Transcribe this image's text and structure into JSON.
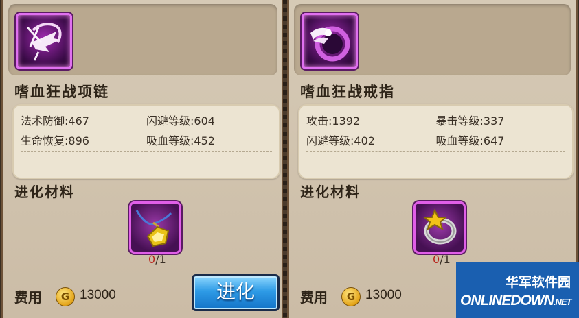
{
  "left": {
    "item_name": "嗜血狂战项链",
    "stats": [
      {
        "label": "法术防御:467"
      },
      {
        "label": "闪避等级:604"
      },
      {
        "label": "生命恢复:896"
      },
      {
        "label": "吸血等级:452"
      }
    ],
    "evolution_title": "进化材料",
    "material_count_current": "0",
    "material_count_total": "/1",
    "cost_label": "费用",
    "coin_symbol": "G",
    "cost_value": "13000",
    "evolve_button_label": "进化"
  },
  "right": {
    "item_name": "嗜血狂战戒指",
    "stats": [
      {
        "label": "攻击:1392"
      },
      {
        "label": "暴击等级:337"
      },
      {
        "label": "闪避等级:402"
      },
      {
        "label": "吸血等级:647"
      }
    ],
    "evolution_title": "进化材料",
    "material_count_current": "0",
    "material_count_total": "/1",
    "cost_label": "费用",
    "coin_symbol": "G",
    "cost_value": "13000"
  },
  "watermark": {
    "cn": "华军软件园",
    "en": "ONLINEDOWN",
    "en_suffix": ".NET"
  },
  "colors": {
    "panel_bg": "#d6cab6",
    "stats_bg": "#ece4d2",
    "item_frame": "#e070f0",
    "button_blue": "#2e9be6",
    "count_red": "#b8231b",
    "watermark_bg": "#1a5fb0"
  },
  "icons": {
    "left_item": "necklace-wing-icon",
    "right_item": "ring-wing-icon",
    "left_material": "gem-pendant-icon",
    "right_material": "gold-ring-icon",
    "coin": "gold-coin-icon"
  }
}
